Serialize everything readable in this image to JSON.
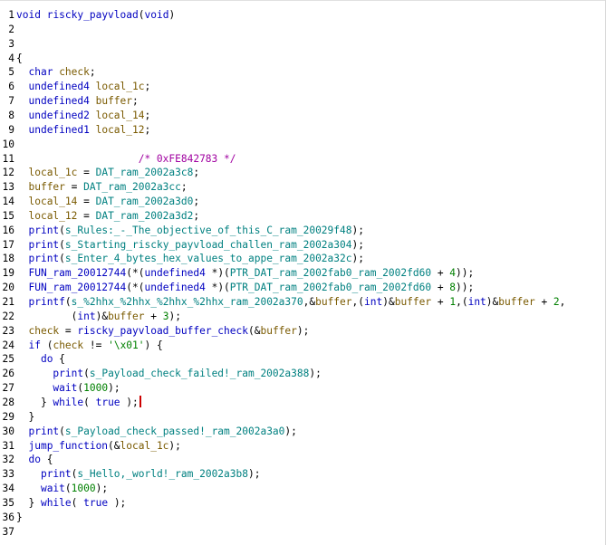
{
  "editor": {
    "lines": [
      {
        "n": "1",
        "tokens": [
          [
            "t-type",
            "void"
          ],
          [
            "t-punc",
            " "
          ],
          [
            "t-func",
            "riscky_payvload"
          ],
          [
            "t-punc",
            "("
          ],
          [
            "t-type",
            "void"
          ],
          [
            "t-punc",
            ")"
          ]
        ]
      },
      {
        "n": "2",
        "tokens": []
      },
      {
        "n": "3",
        "tokens": []
      },
      {
        "n": "4",
        "tokens": [
          [
            "t-punc",
            "{"
          ]
        ]
      },
      {
        "n": "5",
        "tokens": [
          [
            "t-punc",
            "  "
          ],
          [
            "t-type",
            "char"
          ],
          [
            "t-punc",
            " "
          ],
          [
            "t-var",
            "check"
          ],
          [
            "t-punc",
            ";"
          ]
        ]
      },
      {
        "n": "6",
        "tokens": [
          [
            "t-punc",
            "  "
          ],
          [
            "t-type",
            "undefined4"
          ],
          [
            "t-punc",
            " "
          ],
          [
            "t-var",
            "local_1c"
          ],
          [
            "t-punc",
            ";"
          ]
        ]
      },
      {
        "n": "7",
        "tokens": [
          [
            "t-punc",
            "  "
          ],
          [
            "t-type",
            "undefined4"
          ],
          [
            "t-punc",
            " "
          ],
          [
            "t-var",
            "buffer"
          ],
          [
            "t-punc",
            ";"
          ]
        ]
      },
      {
        "n": "8",
        "tokens": [
          [
            "t-punc",
            "  "
          ],
          [
            "t-type",
            "undefined2"
          ],
          [
            "t-punc",
            " "
          ],
          [
            "t-var",
            "local_14"
          ],
          [
            "t-punc",
            ";"
          ]
        ]
      },
      {
        "n": "9",
        "tokens": [
          [
            "t-punc",
            "  "
          ],
          [
            "t-type",
            "undefined1"
          ],
          [
            "t-punc",
            " "
          ],
          [
            "t-var",
            "local_12"
          ],
          [
            "t-punc",
            ";"
          ]
        ]
      },
      {
        "n": "10",
        "tokens": []
      },
      {
        "n": "11",
        "tokens": [
          [
            "t-punc",
            "                    "
          ],
          [
            "t-cmt",
            "/* 0xFE842783 */"
          ]
        ]
      },
      {
        "n": "12",
        "tokens": [
          [
            "t-punc",
            "  "
          ],
          [
            "t-var",
            "local_1c"
          ],
          [
            "t-punc",
            " = "
          ],
          [
            "t-global",
            "DAT_ram_2002a3c8"
          ],
          [
            "t-punc",
            ";"
          ]
        ]
      },
      {
        "n": "13",
        "tokens": [
          [
            "t-punc",
            "  "
          ],
          [
            "t-var",
            "buffer"
          ],
          [
            "t-punc",
            " = "
          ],
          [
            "t-global",
            "DAT_ram_2002a3cc"
          ],
          [
            "t-punc",
            ";"
          ]
        ]
      },
      {
        "n": "14",
        "tokens": [
          [
            "t-punc",
            "  "
          ],
          [
            "t-var",
            "local_14"
          ],
          [
            "t-punc",
            " = "
          ],
          [
            "t-global",
            "DAT_ram_2002a3d0"
          ],
          [
            "t-punc",
            ";"
          ]
        ]
      },
      {
        "n": "15",
        "tokens": [
          [
            "t-punc",
            "  "
          ],
          [
            "t-var",
            "local_12"
          ],
          [
            "t-punc",
            " = "
          ],
          [
            "t-global",
            "DAT_ram_2002a3d2"
          ],
          [
            "t-punc",
            ";"
          ]
        ]
      },
      {
        "n": "16",
        "tokens": [
          [
            "t-punc",
            "  "
          ],
          [
            "t-func",
            "print"
          ],
          [
            "t-punc",
            "("
          ],
          [
            "t-global",
            "s_Rules:_-_The_objective_of_this_C_ram_20029f48"
          ],
          [
            "t-punc",
            ");"
          ]
        ]
      },
      {
        "n": "17",
        "tokens": [
          [
            "t-punc",
            "  "
          ],
          [
            "t-func",
            "print"
          ],
          [
            "t-punc",
            "("
          ],
          [
            "t-global",
            "s_Starting_riscky_payvload_challen_ram_2002a304"
          ],
          [
            "t-punc",
            ");"
          ]
        ]
      },
      {
        "n": "18",
        "tokens": [
          [
            "t-punc",
            "  "
          ],
          [
            "t-func",
            "print"
          ],
          [
            "t-punc",
            "("
          ],
          [
            "t-global",
            "s_Enter_4_bytes_hex_values_to_appe_ram_2002a32c"
          ],
          [
            "t-punc",
            ");"
          ]
        ]
      },
      {
        "n": "19",
        "tokens": [
          [
            "t-punc",
            "  "
          ],
          [
            "t-func",
            "FUN_ram_20012744"
          ],
          [
            "t-punc",
            "(*("
          ],
          [
            "t-type",
            "undefined4"
          ],
          [
            "t-punc",
            " *)("
          ],
          [
            "t-global",
            "PTR_DAT_ram_2002fab0_ram_2002fd60"
          ],
          [
            "t-punc",
            " + "
          ],
          [
            "t-num",
            "4"
          ],
          [
            "t-punc",
            "));"
          ]
        ]
      },
      {
        "n": "20",
        "tokens": [
          [
            "t-punc",
            "  "
          ],
          [
            "t-func",
            "FUN_ram_20012744"
          ],
          [
            "t-punc",
            "(*("
          ],
          [
            "t-type",
            "undefined4"
          ],
          [
            "t-punc",
            " *)("
          ],
          [
            "t-global",
            "PTR_DAT_ram_2002fab0_ram_2002fd60"
          ],
          [
            "t-punc",
            " + "
          ],
          [
            "t-num",
            "8"
          ],
          [
            "t-punc",
            "));"
          ]
        ]
      },
      {
        "n": "21",
        "tokens": [
          [
            "t-punc",
            "  "
          ],
          [
            "t-func",
            "printf"
          ],
          [
            "t-punc",
            "("
          ],
          [
            "t-global",
            "s_%2hhx_%2hhx_%2hhx_%2hhx_ram_2002a370"
          ],
          [
            "t-punc",
            ",&"
          ],
          [
            "t-var",
            "buffer"
          ],
          [
            "t-punc",
            ",("
          ],
          [
            "t-type",
            "int"
          ],
          [
            "t-punc",
            ")&"
          ],
          [
            "t-var",
            "buffer"
          ],
          [
            "t-punc",
            " + "
          ],
          [
            "t-num",
            "1"
          ],
          [
            "t-punc",
            ",("
          ],
          [
            "t-type",
            "int"
          ],
          [
            "t-punc",
            ")&"
          ],
          [
            "t-var",
            "buffer"
          ],
          [
            "t-punc",
            " + "
          ],
          [
            "t-num",
            "2"
          ],
          [
            "t-punc",
            ","
          ]
        ]
      },
      {
        "n": "22",
        "tokens": [
          [
            "t-punc",
            "         ("
          ],
          [
            "t-type",
            "int"
          ],
          [
            "t-punc",
            ")&"
          ],
          [
            "t-var",
            "buffer"
          ],
          [
            "t-punc",
            " + "
          ],
          [
            "t-num",
            "3"
          ],
          [
            "t-punc",
            ");"
          ]
        ]
      },
      {
        "n": "23",
        "tokens": [
          [
            "t-punc",
            "  "
          ],
          [
            "t-var",
            "check"
          ],
          [
            "t-punc",
            " = "
          ],
          [
            "t-func",
            "riscky_payvload_buffer_check"
          ],
          [
            "t-punc",
            "(&"
          ],
          [
            "t-var",
            "buffer"
          ],
          [
            "t-punc",
            ");"
          ]
        ]
      },
      {
        "n": "24",
        "tokens": [
          [
            "t-punc",
            "  "
          ],
          [
            "t-kw",
            "if"
          ],
          [
            "t-punc",
            " ("
          ],
          [
            "t-var",
            "check"
          ],
          [
            "t-punc",
            " != "
          ],
          [
            "t-str",
            "'\\x01'"
          ],
          [
            "t-punc",
            ") {"
          ]
        ]
      },
      {
        "n": "25",
        "tokens": [
          [
            "t-punc",
            "    "
          ],
          [
            "t-kw",
            "do"
          ],
          [
            "t-punc",
            " {"
          ]
        ]
      },
      {
        "n": "26",
        "tokens": [
          [
            "t-punc",
            "      "
          ],
          [
            "t-func",
            "print"
          ],
          [
            "t-punc",
            "("
          ],
          [
            "t-global",
            "s_Payload_check_failed!_ram_2002a388"
          ],
          [
            "t-punc",
            ");"
          ]
        ]
      },
      {
        "n": "27",
        "tokens": [
          [
            "t-punc",
            "      "
          ],
          [
            "t-func",
            "wait"
          ],
          [
            "t-punc",
            "("
          ],
          [
            "t-num",
            "1000"
          ],
          [
            "t-punc",
            ");"
          ]
        ]
      },
      {
        "n": "28",
        "tokens": [
          [
            "t-punc",
            "    } "
          ],
          [
            "t-kw",
            "while"
          ],
          [
            "t-punc",
            "( "
          ],
          [
            "t-kw",
            "true"
          ],
          [
            "t-punc",
            " );"
          ]
        ],
        "cursor": true
      },
      {
        "n": "29",
        "tokens": [
          [
            "t-punc",
            "  }"
          ]
        ]
      },
      {
        "n": "30",
        "tokens": [
          [
            "t-punc",
            "  "
          ],
          [
            "t-func",
            "print"
          ],
          [
            "t-punc",
            "("
          ],
          [
            "t-global",
            "s_Payload_check_passed!_ram_2002a3a0"
          ],
          [
            "t-punc",
            ");"
          ]
        ]
      },
      {
        "n": "31",
        "tokens": [
          [
            "t-punc",
            "  "
          ],
          [
            "t-func",
            "jump_function"
          ],
          [
            "t-punc",
            "(&"
          ],
          [
            "t-var",
            "local_1c"
          ],
          [
            "t-punc",
            ");"
          ]
        ]
      },
      {
        "n": "32",
        "tokens": [
          [
            "t-punc",
            "  "
          ],
          [
            "t-kw",
            "do"
          ],
          [
            "t-punc",
            " {"
          ]
        ]
      },
      {
        "n": "33",
        "tokens": [
          [
            "t-punc",
            "    "
          ],
          [
            "t-func",
            "print"
          ],
          [
            "t-punc",
            "("
          ],
          [
            "t-global",
            "s_Hello,_world!_ram_2002a3b8"
          ],
          [
            "t-punc",
            ");"
          ]
        ]
      },
      {
        "n": "34",
        "tokens": [
          [
            "t-punc",
            "    "
          ],
          [
            "t-func",
            "wait"
          ],
          [
            "t-punc",
            "("
          ],
          [
            "t-num",
            "1000"
          ],
          [
            "t-punc",
            ");"
          ]
        ]
      },
      {
        "n": "35",
        "tokens": [
          [
            "t-punc",
            "  } "
          ],
          [
            "t-kw",
            "while"
          ],
          [
            "t-punc",
            "( "
          ],
          [
            "t-kw",
            "true"
          ],
          [
            "t-punc",
            " );"
          ]
        ]
      },
      {
        "n": "36",
        "tokens": [
          [
            "t-punc",
            "}"
          ]
        ]
      },
      {
        "n": "37",
        "tokens": []
      }
    ]
  }
}
